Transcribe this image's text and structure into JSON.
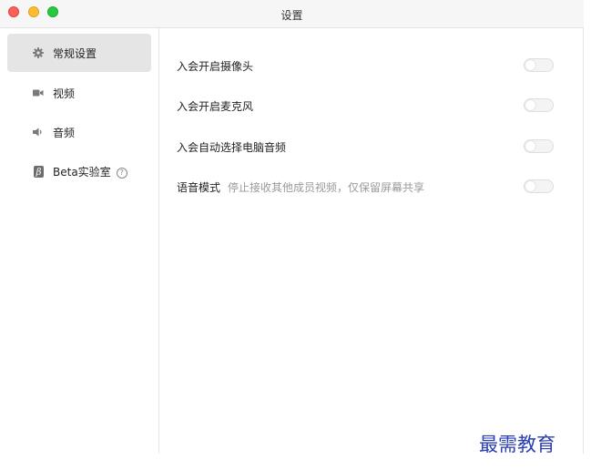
{
  "window": {
    "title": "设置"
  },
  "sidebar": {
    "items": [
      {
        "label": "常规设置",
        "icon": "gear-icon",
        "active": true
      },
      {
        "label": "视频",
        "icon": "video-camera-icon",
        "active": false
      },
      {
        "label": "音频",
        "icon": "speaker-icon",
        "active": false
      },
      {
        "label": "Beta实验室",
        "icon": "beta-icon",
        "active": false
      }
    ]
  },
  "settings": {
    "rows": [
      {
        "label": "入会开启摄像头",
        "description": "",
        "enabled": false
      },
      {
        "label": "入会开启麦克风",
        "description": "",
        "enabled": false
      },
      {
        "label": "入会自动选择电脑音频",
        "description": "",
        "enabled": false
      },
      {
        "label": "语音模式",
        "description": "停止接收其他成员视频，仅保留屏幕共享",
        "enabled": false
      }
    ]
  },
  "watermark": {
    "text": "最需教育"
  },
  "colors": {
    "close": "#fe5f57",
    "minimize": "#febc2e",
    "maximize": "#28c840",
    "active_item_bg": "#e5e5e5",
    "watermark": "#2b3fb0"
  }
}
